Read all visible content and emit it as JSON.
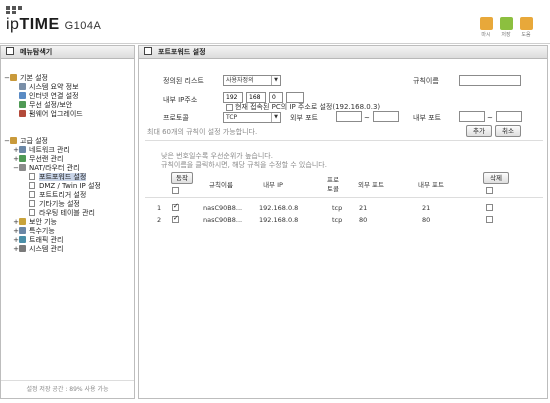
{
  "header": {
    "brand_ip": "ip",
    "brand_time": "TIME",
    "model": "G104A",
    "buttons": [
      {
        "label": "마시",
        "color": "#e8a83a"
      },
      {
        "label": "저장",
        "color": "#8cbf3f"
      },
      {
        "label": "도움",
        "color": "#e8a83a"
      }
    ]
  },
  "sidebar": {
    "title": "메뉴탐색기",
    "basic": {
      "label": "기본 설정",
      "items": [
        "시스템 요약 정보",
        "인터넷 연결 설정",
        "무선 설정/보안",
        "펌웨어 업그레이드"
      ]
    },
    "advanced": {
      "label": "고급 설정",
      "items": [
        "네트워크 관리",
        "무선랜 관리",
        "NAT/라우터 관리"
      ],
      "nat_items": [
        "포트포워드 설정",
        "DMZ / Twin IP 설정",
        "포트트리거 설정",
        "기타기능 설정",
        "라우팅 테이블 관리"
      ],
      "more_items": [
        "보안 기능",
        "특수기능",
        "트래픽 관리",
        "시스템 관리"
      ]
    },
    "footer": "설정 저장 공간 : 89% 사용 가능"
  },
  "main": {
    "title": "포트포워드 설정",
    "form": {
      "preset_label": "정의된 리스트",
      "preset_value": "사용자정의",
      "rule_name_label": "규칙이름",
      "rule_name_value": "",
      "internal_ip_label": "내부 IP주소",
      "ip_octets": [
        "192",
        "168",
        "0",
        ""
      ],
      "current_ip_text": "현재 접속된 PC의 IP 주소로 설정(192.168.0.3)",
      "protocol_label": "프로토콜",
      "protocol_value": "TCP",
      "external_port_label": "외부 포트",
      "internal_port_label": "내부 포트",
      "tilde": "~",
      "max_rules_text": "최대 60개의 규칙이 설정 가능합니다.",
      "add_button": "추가",
      "cancel_button": "취소"
    },
    "notes": [
      "낮은 번호일수록 우선순위가 높습니다.",
      "규칙이름을 클릭하시면, 해당 규칙을 수정할 수 있습니다."
    ],
    "table": {
      "action_button": "동작",
      "delete_button": "삭제",
      "headers": [
        "규칙이름",
        "내부 IP",
        "프로\n토콜",
        "외부 포트",
        "내부 포트"
      ],
      "header_protocol_1": "프로",
      "header_protocol_2": "토콜",
      "rows": [
        {
          "no": "1",
          "enabled": true,
          "name": "nasC90B8...",
          "ip": "192.168.0.8",
          "proto": "tcp",
          "ext": "21",
          "int": "21"
        },
        {
          "no": "2",
          "enabled": true,
          "name": "nasC90B8...",
          "ip": "192.168.0.8",
          "proto": "tcp",
          "ext": "80",
          "int": "80"
        }
      ]
    }
  }
}
